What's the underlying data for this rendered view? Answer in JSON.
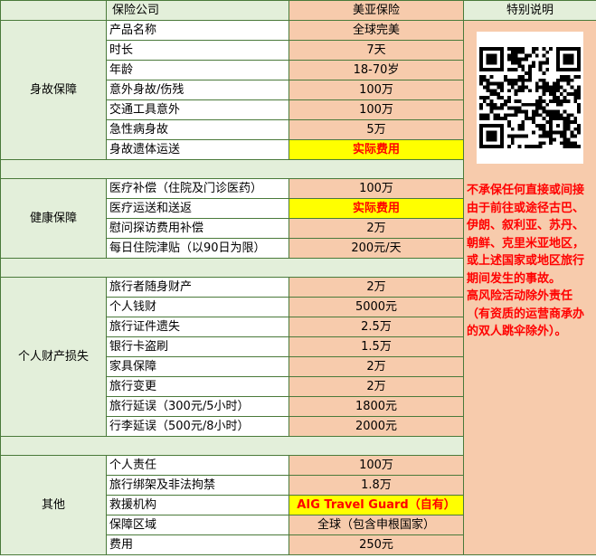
{
  "header": {
    "company_label": "保险公司",
    "brand": "美亚保险",
    "notes_title": "特别说明"
  },
  "sections": {
    "death": {
      "title": "身故保障",
      "rows": [
        {
          "label": "产品名称",
          "value": "全球完美"
        },
        {
          "label": "时长",
          "value": "7天"
        },
        {
          "label": "年龄",
          "value": "18-70岁"
        },
        {
          "label": "意外身故/伤残",
          "value": "100万"
        },
        {
          "label": "交通工具意外",
          "value": "100万"
        },
        {
          "label": "急性病身故",
          "value": "5万"
        },
        {
          "label": "身故遗体运送",
          "value": "实际费用"
        }
      ]
    },
    "health": {
      "title": "健康保障",
      "rows": [
        {
          "label": "医疗补偿（住院及门诊医药）",
          "value": "100万"
        },
        {
          "label": "医疗运送和送返",
          "value": "实际费用"
        },
        {
          "label": "慰问探访费用补偿",
          "value": "2万"
        },
        {
          "label": "每日住院津贴（以90日为限）",
          "value": "200元/天"
        }
      ]
    },
    "property": {
      "title": "个人财产损失",
      "rows": [
        {
          "label": "旅行者随身财产",
          "value": "2万"
        },
        {
          "label": "个人钱财",
          "value": "5000元"
        },
        {
          "label": "旅行证件遗失",
          "value": "2.5万"
        },
        {
          "label": "银行卡盗刷",
          "value": "1.5万"
        },
        {
          "label": "家具保障",
          "value": "2万"
        },
        {
          "label": "旅行变更",
          "value": "2万"
        },
        {
          "label": "旅行延误（300元/5小时）",
          "value": "1800元"
        },
        {
          "label": "行李延误（500元/8小时）",
          "value": "2000元"
        }
      ]
    },
    "other": {
      "title": "其他",
      "rows": [
        {
          "label": "个人责任",
          "value": "100万"
        },
        {
          "label": "旅行绑架及非法拘禁",
          "value": "1.8万"
        },
        {
          "label": "救援机构",
          "value": "AIG Travel Guard（自有）"
        },
        {
          "label": "保障区域",
          "value": "全球（包含申根国家）"
        },
        {
          "label": "费用",
          "value": "250元"
        }
      ]
    }
  },
  "notes": {
    "exclusion_text": "不承保任何直接或间接由于前往或途径古巴、伊朗、叙利亚、苏丹、朝鲜、克里米亚地区，或上述国家或地区旅行期间发生的事故。",
    "high_risk_text": "高风险活动除外责任（有资质的运营商承办的双人跳伞除外）。"
  },
  "colors": {
    "category_bg": "#e3efda",
    "value_bg": "#f7cbac",
    "highlight_bg": "#ffff00",
    "highlight_text": "#ff0000",
    "border": "#4a7a3a"
  }
}
